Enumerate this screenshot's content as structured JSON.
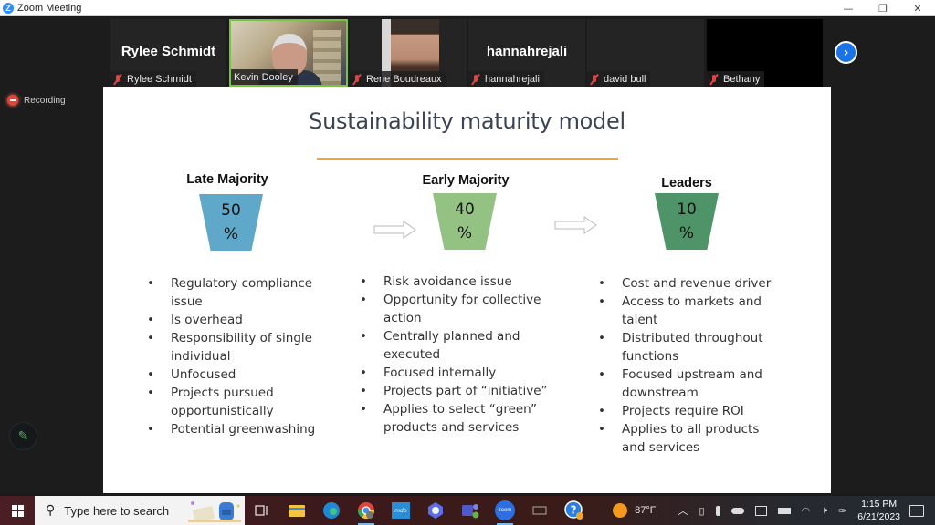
{
  "window": {
    "title": "Zoom Meeting",
    "controls": {
      "minimize": "—",
      "restore": "❐",
      "close": "✕"
    }
  },
  "participants": [
    {
      "display_name": "Rylee Schmidt",
      "label": "Rylee Schmidt",
      "muted": true,
      "video": false
    },
    {
      "display_name": "",
      "label": "Kevin Dooley",
      "muted": false,
      "video": true,
      "speaking": true
    },
    {
      "display_name": "",
      "label": "Rene Boudreaux",
      "muted": true,
      "video": true
    },
    {
      "display_name": "hannahrejali",
      "label": "hannahrejali",
      "muted": true,
      "video": false
    },
    {
      "display_name": "",
      "label": "david bull",
      "muted": true,
      "video": false
    },
    {
      "display_name": "",
      "label": "Bethany",
      "muted": true,
      "video": false
    }
  ],
  "next_page_icon": "›",
  "recording": {
    "label": "Recording"
  },
  "annotate_icon": "✎",
  "slide": {
    "title": "Sustainability maturity model",
    "accent_color": "#f0a43a",
    "stages": [
      {
        "heading": "Late Majority",
        "percent": "50",
        "percent_sign": "%",
        "color": "#5fa8c9",
        "bullets": [
          "Regulatory compliance issue",
          "Is overhead",
          "Responsibility of single individual",
          "Unfocused",
          "Projects pursued opportunistically",
          "Potential greenwashing"
        ]
      },
      {
        "heading": "Early Majority",
        "percent": "40",
        "percent_sign": "%",
        "color": "#93c283",
        "bullets": [
          "Risk avoidance issue",
          "Opportunity for collective action",
          "Centrally planned and executed",
          "Focused internally",
          "Projects part of “initiative”",
          "Applies to select “green” products and services"
        ]
      },
      {
        "heading": "Leaders",
        "percent": "10",
        "percent_sign": "%",
        "color": "#4f9468",
        "bullets": [
          "Cost and revenue driver",
          "Access to markets and talent",
          "Distributed throughout functions",
          "Focused upstream and downstream",
          "Projects require ROI",
          "Applies to all products and services"
        ]
      }
    ]
  },
  "taskbar": {
    "search_placeholder": "Type here to search",
    "weather": "87°F",
    "time": "1:15 PM",
    "date": "6/21/2023",
    "zoom_app_label": "zoom",
    "mdp_app_label": "mdp"
  }
}
